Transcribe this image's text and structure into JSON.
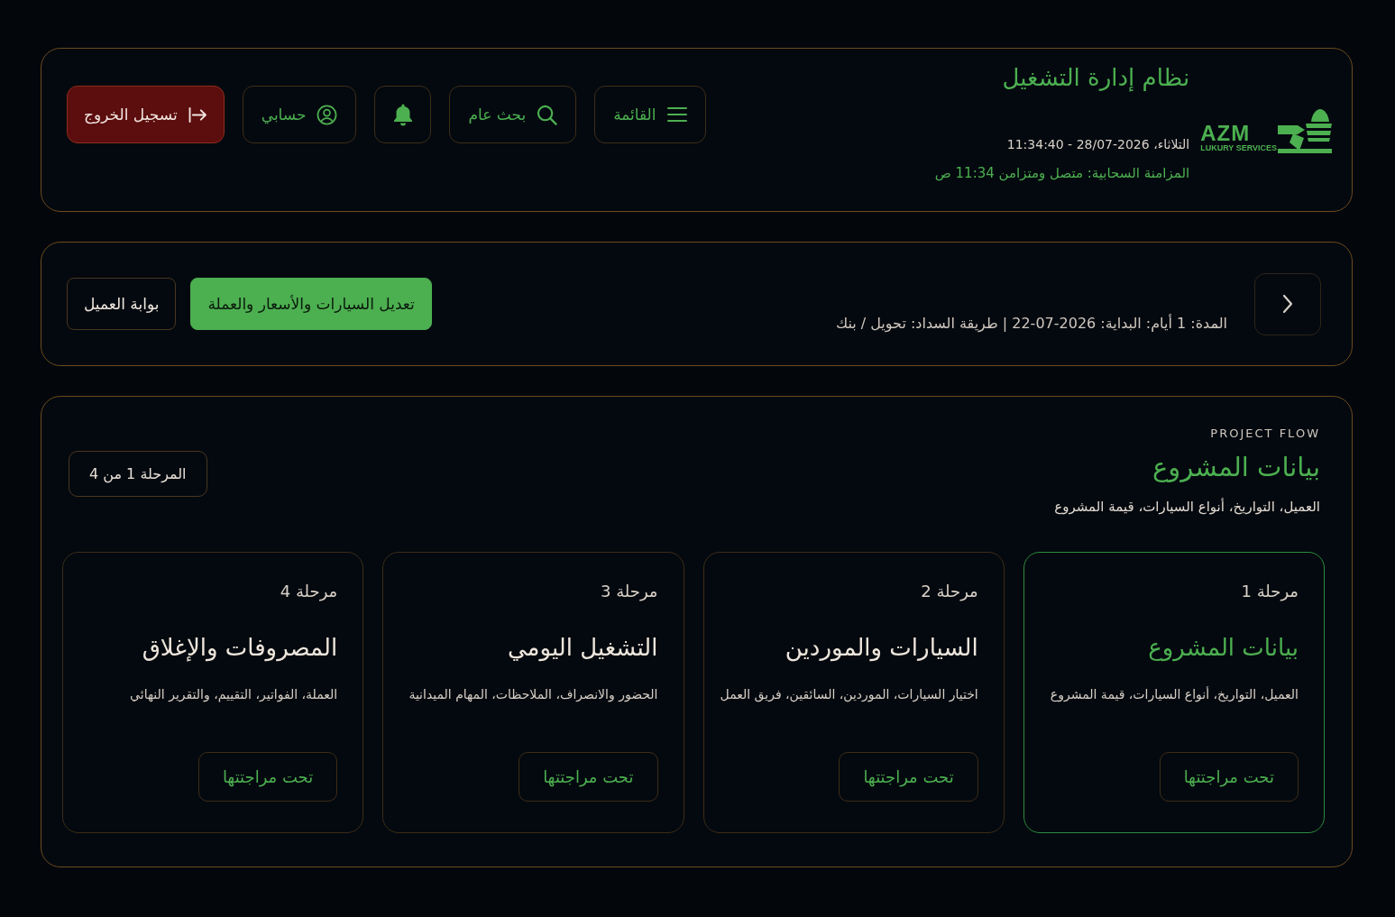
{
  "header": {
    "title": "نظام إدارة التشغيل",
    "logo": {
      "wordmark": "AZM",
      "tagline": "LUKURY SERVICES"
    },
    "datetime": "التلاثاء، 2026-28/07 - 11:34:40",
    "sync_status": "المزامنة السحابية: متصل ومتزامن 11:34 ص",
    "buttons": [
      {
        "kind": "menu",
        "label": "القائمة"
      },
      {
        "kind": "search",
        "label": "بحث عام"
      },
      {
        "kind": "notifications"
      },
      {
        "kind": "account",
        "label": "حسابي"
      },
      {
        "kind": "logout",
        "label": "تسجيل الخروج"
      }
    ]
  },
  "project_bar": {
    "summary": "المدة: 1 أيام: البداية: 2026-07-22 | طريقة السداد: تحويل / بنك",
    "buttons": [
      {
        "kind": "primary",
        "label": "تعديل السيارات والأسعار والعملة"
      },
      {
        "kind": "secondary",
        "label": "بوابة العميل"
      }
    ]
  },
  "project_flow": {
    "eyebrow": "PROJECT FLOW",
    "title": "بيانات المشروع",
    "subtitle": "العميل، التواريخ، أنواع السيارات، قيمة المشروع",
    "stage_indicator": "المرحلة 1 من 4",
    "stages": [
      {
        "label": "مرحلة 1",
        "title": "بيانات المشروع",
        "description": "العميل، التواريخ، أنواع السيارات، قيمة المشروع",
        "status": "تحت مراجتتها",
        "selected": true
      },
      {
        "label": "مرحلة 2",
        "title": "السيارات والموردين",
        "description": "اختيار السيارات، الموردين، السائقين، فريق العمل",
        "status": "تحت مراجتتها",
        "selected": false
      },
      {
        "label": "مرحلة 3",
        "title": "التشغيل اليومي",
        "description": "الحضور والانصراف، الملاحظات، المهام الميدانية",
        "status": "تحت مراجتتها",
        "selected": false
      },
      {
        "label": "مرحلة 4",
        "title": "المصروفات والإغلاق",
        "description": "العملة، الفواتير، التقييم، والتقرير النهائي",
        "status": "تحت مراجتتها",
        "selected": false
      }
    ]
  }
}
